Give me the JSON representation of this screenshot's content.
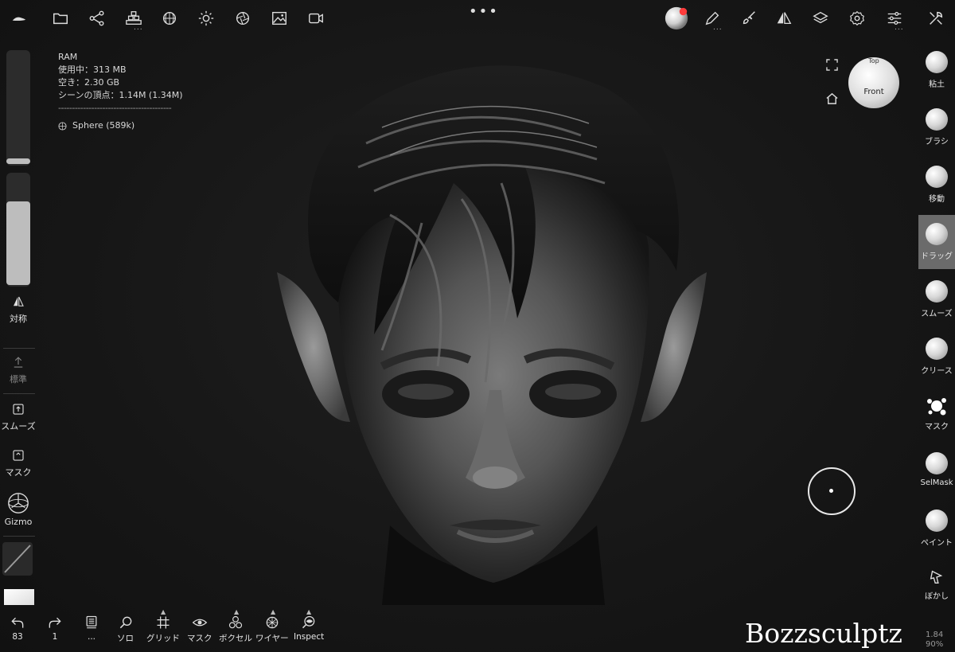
{
  "top_toolbar": {
    "more_dots": "•••",
    "icons": [
      "logo-icon",
      "folder-icon",
      "scene-graph-icon",
      "primitives-icon",
      "sphere-grid-icon",
      "light-icon",
      "camera-aperture-icon",
      "image-icon",
      "video-icon"
    ],
    "right_icons": [
      "material-ball-icon",
      "pen-icon",
      "brush-icon",
      "symmetry-icon",
      "layers-icon",
      "gear-icon",
      "sliders-icon",
      "tools-icon"
    ]
  },
  "info": {
    "ram_label": "RAM",
    "used": "使用中：313 MB",
    "free": "空き：2.30 GB",
    "vertices": "シーンの頂点：1.14M (1.34M)",
    "separator": "-----------------------------------------",
    "object": "Sphere (589k)"
  },
  "left_panel": {
    "symmetry": "対称",
    "standard": "標準",
    "smooth": "スムーズ",
    "mask": "マスク",
    "gizmo": "Gizmo"
  },
  "right_tools": [
    {
      "label": "粘土",
      "active": false
    },
    {
      "label": "ブラシ",
      "active": false
    },
    {
      "label": "移動",
      "active": false
    },
    {
      "label": "ドラッグ",
      "active": true
    },
    {
      "label": "スムーズ",
      "active": false
    },
    {
      "label": "クリース",
      "active": false
    },
    {
      "label": "マスク",
      "active": false
    },
    {
      "label": "SelMask",
      "active": false
    },
    {
      "label": "ペイント",
      "active": false
    },
    {
      "label": "ぼかし",
      "active": false
    }
  ],
  "view_cube": {
    "top": "Top",
    "front": "Front"
  },
  "bottom_bar": {
    "undo_count": "83",
    "redo_count": "1",
    "solo": "ソロ",
    "grid": "グリッド",
    "mask": "マスク",
    "voxel": "ボクセル",
    "wire": "ワイヤー",
    "inspect": "Inspect",
    "ellipsis": "..."
  },
  "watermark": "Bozzsculptz",
  "version": {
    "line1": "1.84",
    "line2": "90%"
  }
}
